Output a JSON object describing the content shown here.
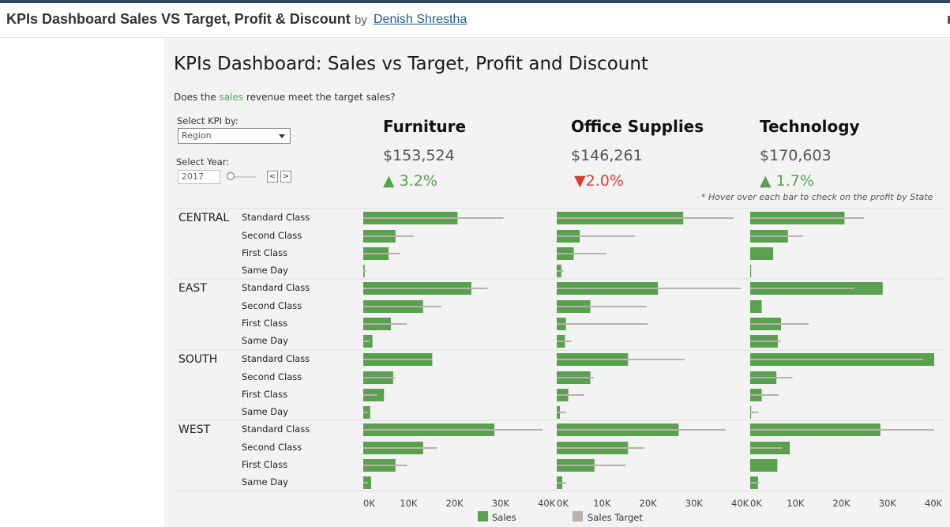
{
  "header": {
    "title": "KPIs Dashboard Sales VS Target, Profit & Discount",
    "by": "by",
    "author": "Denish Shrestha"
  },
  "dashboard": {
    "title": "KPIs Dashboard: Sales vs Target, Profit and Discount",
    "subtitle_pre": "Does the ",
    "subtitle_highlight": "sales",
    "subtitle_post": " revenue meet the target sales?",
    "hint": "* Hover over each bar to check on the profit by State"
  },
  "controls": {
    "kpi_label": "Select KPI by:",
    "kpi_value": "Region",
    "year_label": "Select Year:",
    "year_value": "2017",
    "prev_symbol": "<",
    "next_symbol": ">"
  },
  "kpis": [
    {
      "name": "Furniture",
      "value": "$153,524",
      "arrow": "▲",
      "change": "3.2%",
      "direction": "up"
    },
    {
      "name": "Office Supplies",
      "value": "$146,261",
      "arrow": "▼",
      "change": "2.0%",
      "direction": "down"
    },
    {
      "name": "Technology",
      "value": "$170,603",
      "arrow": "▲",
      "change": "1.7%",
      "direction": "up"
    }
  ],
  "legend": {
    "sales": "Sales",
    "target": "Sales Target"
  },
  "colors": {
    "sales": "#59a14f",
    "target": "#bab0ac",
    "up": "#59a14f",
    "down": "#e03c31"
  },
  "chart_data": {
    "type": "bar",
    "orientation": "horizontal",
    "categories_regions": [
      "CENTRAL",
      "EAST",
      "SOUTH",
      "WEST"
    ],
    "ship_modes": [
      "Standard Class",
      "Second Class",
      "First Class",
      "Same Day"
    ],
    "panels": [
      "Furniture",
      "Office Supplies",
      "Technology"
    ],
    "xlim": [
      0,
      40000
    ],
    "x_ticks": [
      "0K",
      "10K",
      "20K",
      "30K",
      "40K"
    ],
    "series": [
      {
        "name": "Sales",
        "values": {
          "Furniture": [
            [
              20500,
              7000,
              5500,
              300
            ],
            [
              23500,
              13000,
              6000,
              2000
            ],
            [
              15000,
              6500,
              4500,
              1500
            ],
            [
              28500,
              13000,
              7000,
              1700
            ]
          ],
          "Office Supplies": [
            [
              27500,
              5000,
              3700,
              1000
            ],
            [
              22000,
              7300,
              2000,
              1800
            ],
            [
              15500,
              7300,
              2500,
              700
            ],
            [
              26500,
              15500,
              8200,
              1200
            ]
          ],
          "Technology": [
            [
              20500,
              8200,
              5000,
              200
            ],
            [
              28800,
              2500,
              6700,
              6000
            ],
            [
              42500,
              5700,
              2500,
              200
            ],
            [
              28300,
              8600,
              5900,
              1700
            ]
          ]
        }
      },
      {
        "name": "Sales Target",
        "values": {
          "Furniture": [
            [
              30500,
              11000,
              8000,
              500
            ],
            [
              27000,
              17000,
              9500,
              1500
            ],
            [
              15000,
              7000,
              3000,
              1000
            ],
            [
              39000,
              16000,
              9500,
              1000
            ]
          ],
          "Office Supplies": [
            [
              38500,
              17000,
              10800,
              1500
            ],
            [
              40000,
              19500,
              19800,
              3200
            ],
            [
              27800,
              8000,
              6000,
              2000
            ],
            [
              36700,
              19000,
              15000,
              2000
            ]
          ],
          "Technology": [
            [
              24800,
              11500,
              0,
              0
            ],
            [
              22600,
              0,
              12700,
              6700
            ],
            [
              37500,
              9200,
              6200,
              1800
            ],
            [
              42800,
              6800,
              0,
              2000
            ]
          ]
        }
      }
    ]
  }
}
